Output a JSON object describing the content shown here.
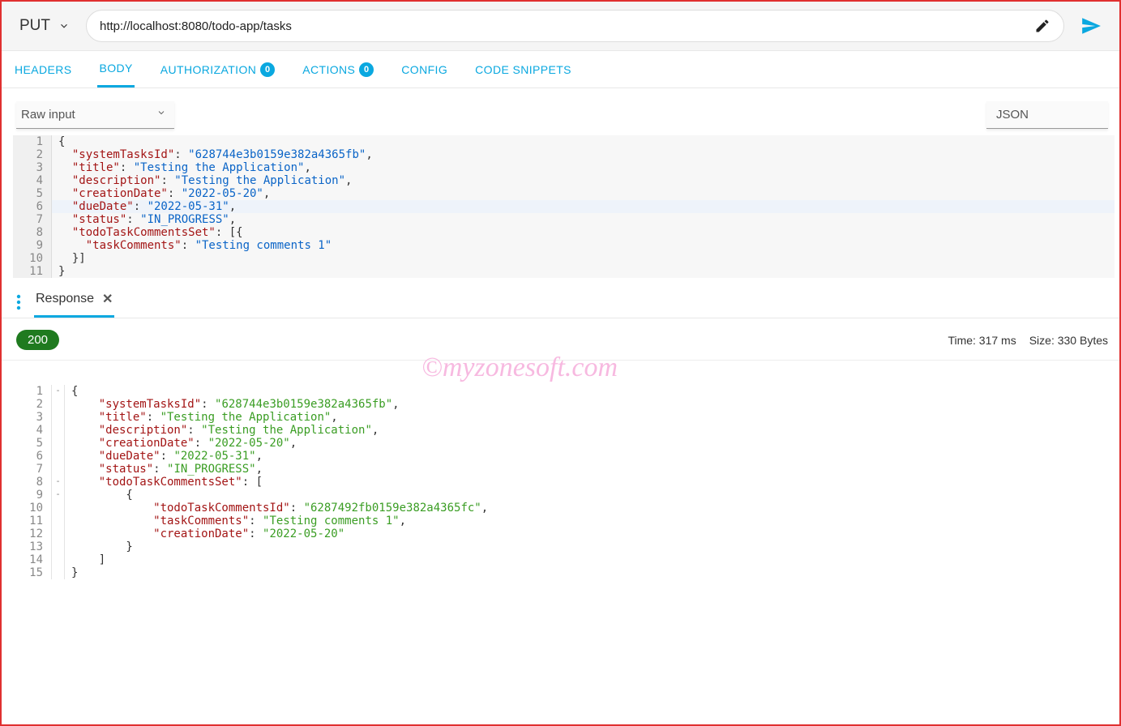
{
  "topbar": {
    "method": "PUT",
    "url": "http://localhost:8080/todo-app/tasks"
  },
  "tabs": {
    "headers": "HEADERS",
    "body": "BODY",
    "authorization": "AUTHORIZATION",
    "auth_badge": "0",
    "actions": "ACTIONS",
    "actions_badge": "0",
    "config": "CONFIG",
    "snippets": "CODE SNIPPETS"
  },
  "subbar": {
    "raw_input": "Raw input",
    "json": "JSON"
  },
  "request_body": {
    "lines": [
      {
        "n": "1",
        "tokens": [
          [
            "punc",
            "{"
          ]
        ]
      },
      {
        "n": "2",
        "tokens": [
          [
            "key",
            "  \"systemTasksId\""
          ],
          [
            "punc",
            ": "
          ],
          [
            "str",
            "\"628744e3b0159e382a4365fb\""
          ],
          [
            "punc",
            ","
          ]
        ]
      },
      {
        "n": "3",
        "tokens": [
          [
            "key",
            "  \"title\""
          ],
          [
            "punc",
            ": "
          ],
          [
            "str",
            "\"Testing the Application\""
          ],
          [
            "punc",
            ","
          ]
        ]
      },
      {
        "n": "4",
        "tokens": [
          [
            "key",
            "  \"description\""
          ],
          [
            "punc",
            ": "
          ],
          [
            "str",
            "\"Testing the Application\""
          ],
          [
            "punc",
            ","
          ]
        ]
      },
      {
        "n": "5",
        "tokens": [
          [
            "key",
            "  \"creationDate\""
          ],
          [
            "punc",
            ": "
          ],
          [
            "str",
            "\"2022-05-20\""
          ],
          [
            "punc",
            ","
          ]
        ]
      },
      {
        "n": "6",
        "hl": true,
        "tokens": [
          [
            "key",
            "  \"dueDate\""
          ],
          [
            "punc",
            ": "
          ],
          [
            "str",
            "\"2022-05-31\""
          ],
          [
            "punc",
            ","
          ]
        ]
      },
      {
        "n": "7",
        "tokens": [
          [
            "key",
            "  \"status\""
          ],
          [
            "punc",
            ": "
          ],
          [
            "str",
            "\"IN_PROGRESS\""
          ],
          [
            "punc",
            ","
          ]
        ]
      },
      {
        "n": "8",
        "tokens": [
          [
            "key",
            "  \"todoTaskCommentsSet\""
          ],
          [
            "punc",
            ": [{"
          ]
        ]
      },
      {
        "n": "9",
        "tokens": [
          [
            "key",
            "    \"taskComments\""
          ],
          [
            "punc",
            ": "
          ],
          [
            "str",
            "\"Testing comments 1\""
          ]
        ]
      },
      {
        "n": "10",
        "tokens": [
          [
            "punc",
            "  }]"
          ]
        ]
      },
      {
        "n": "11",
        "tokens": [
          [
            "punc",
            "}"
          ]
        ]
      }
    ]
  },
  "response_header": {
    "tab_label": "Response",
    "status": "200",
    "time_label": "Time: 317 ms",
    "size_label": "Size: 330 Bytes"
  },
  "response_body": {
    "lines": [
      {
        "n": "1",
        "fold": "-",
        "tokens": [
          [
            "punc",
            "{"
          ]
        ]
      },
      {
        "n": "2",
        "tokens": [
          [
            "key",
            "    \"systemTasksId\""
          ],
          [
            "punc",
            ": "
          ],
          [
            "str2",
            "\"628744e3b0159e382a4365fb\""
          ],
          [
            "punc",
            ","
          ]
        ]
      },
      {
        "n": "3",
        "tokens": [
          [
            "key",
            "    \"title\""
          ],
          [
            "punc",
            ": "
          ],
          [
            "str2",
            "\"Testing the Application\""
          ],
          [
            "punc",
            ","
          ]
        ]
      },
      {
        "n": "4",
        "tokens": [
          [
            "key",
            "    \"description\""
          ],
          [
            "punc",
            ": "
          ],
          [
            "str2",
            "\"Testing the Application\""
          ],
          [
            "punc",
            ","
          ]
        ]
      },
      {
        "n": "5",
        "tokens": [
          [
            "key",
            "    \"creationDate\""
          ],
          [
            "punc",
            ": "
          ],
          [
            "str2",
            "\"2022-05-20\""
          ],
          [
            "punc",
            ","
          ]
        ]
      },
      {
        "n": "6",
        "tokens": [
          [
            "key",
            "    \"dueDate\""
          ],
          [
            "punc",
            ": "
          ],
          [
            "str2",
            "\"2022-05-31\""
          ],
          [
            "punc",
            ","
          ]
        ]
      },
      {
        "n": "7",
        "tokens": [
          [
            "key",
            "    \"status\""
          ],
          [
            "punc",
            ": "
          ],
          [
            "str2",
            "\"IN_PROGRESS\""
          ],
          [
            "punc",
            ","
          ]
        ]
      },
      {
        "n": "8",
        "fold": "-",
        "tokens": [
          [
            "key",
            "    \"todoTaskCommentsSet\""
          ],
          [
            "punc",
            ": ["
          ]
        ]
      },
      {
        "n": "9",
        "fold": "-",
        "tokens": [
          [
            "punc",
            "        {"
          ]
        ]
      },
      {
        "n": "10",
        "tokens": [
          [
            "key",
            "            \"todoTaskCommentsId\""
          ],
          [
            "punc",
            ": "
          ],
          [
            "str2",
            "\"6287492fb0159e382a4365fc\""
          ],
          [
            "punc",
            ","
          ]
        ]
      },
      {
        "n": "11",
        "tokens": [
          [
            "key",
            "            \"taskComments\""
          ],
          [
            "punc",
            ": "
          ],
          [
            "str2",
            "\"Testing comments 1\""
          ],
          [
            "punc",
            ","
          ]
        ]
      },
      {
        "n": "12",
        "tokens": [
          [
            "key",
            "            \"creationDate\""
          ],
          [
            "punc",
            ": "
          ],
          [
            "str2",
            "\"2022-05-20\""
          ]
        ]
      },
      {
        "n": "13",
        "tokens": [
          [
            "punc",
            "        }"
          ]
        ]
      },
      {
        "n": "14",
        "tokens": [
          [
            "punc",
            "    ]"
          ]
        ]
      },
      {
        "n": "15",
        "tokens": [
          [
            "punc",
            "}"
          ]
        ]
      }
    ]
  },
  "watermark": "©myzonesoft.com"
}
